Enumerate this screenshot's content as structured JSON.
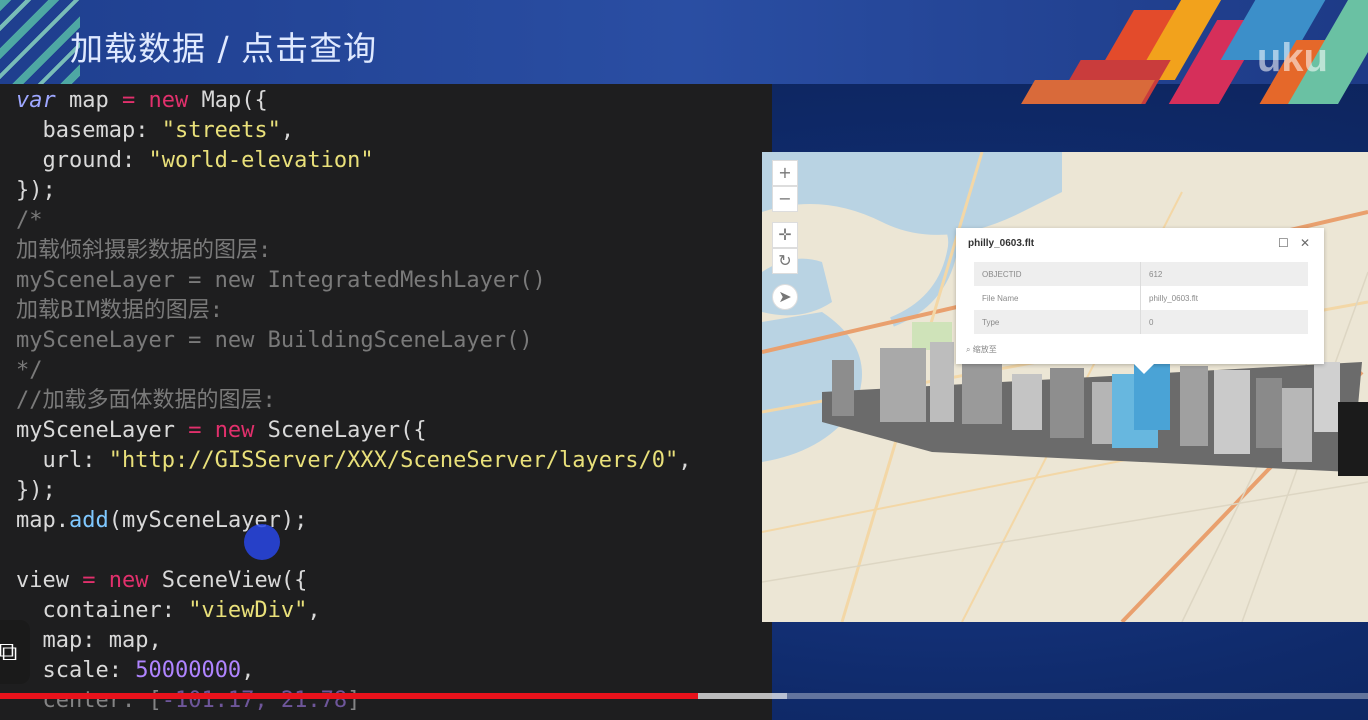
{
  "slide": {
    "title": "加载数据 / 点击查询",
    "logo_text": "uku"
  },
  "code": {
    "lines": [
      "var map = new Map({",
      "  basemap: \"streets\",",
      "  ground: \"world-elevation\"",
      "});",
      "/*",
      "加载倾斜摄影数据的图层:",
      "mySceneLayer = new IntegratedMeshLayer()",
      "加载BIM数据的图层:",
      "mySceneLayer = new BuildingSceneLayer()",
      "*/",
      "//加载多面体数据的图层:",
      "mySceneLayer = new SceneLayer({",
      "  url: \"http://GISServer/XXX/SceneServer/layers/0\",",
      "});",
      "map.add(mySceneLayer);",
      "",
      "view = new SceneView({",
      "  container: \"viewDiv\",",
      "  map: map,",
      "  scale: 50000000,",
      "  center: [-101.17, 21.78]"
    ]
  },
  "map": {
    "zoom_in_label": "+",
    "zoom_out_label": "−",
    "controls": [
      "pan-icon",
      "rotate-icon",
      "compass-icon"
    ]
  },
  "popup": {
    "title": "philly_0603.flt",
    "rows": [
      {
        "field": "OBJECTID",
        "value": "612"
      },
      {
        "field": "File Name",
        "value": "philly_0603.flt"
      },
      {
        "field": "Type",
        "value": "0"
      }
    ],
    "footer": "缩放至"
  },
  "player": {
    "progress": 0.51,
    "buffered": 0.575
  },
  "colors": {
    "header_bg": "#2a4ea3",
    "code_bg": "#1e1e1f",
    "keyword": "#e1306c",
    "string": "#e9e07a",
    "number": "#b084ff",
    "function": "#7fc8ff",
    "comment": "#7a7a7a",
    "progress": "#e8121b"
  }
}
